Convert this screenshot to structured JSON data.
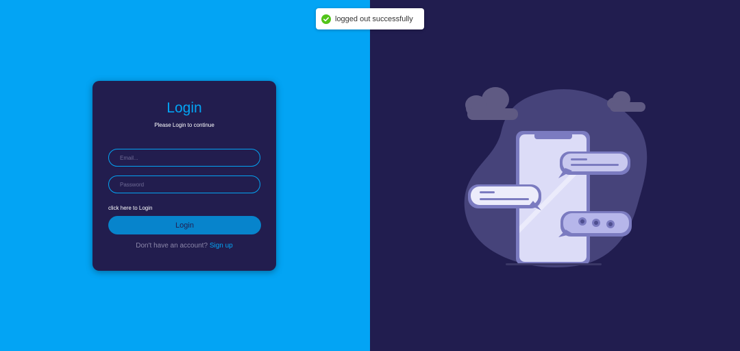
{
  "toast": {
    "message": "logged out successfully",
    "icon": "check-circle-icon",
    "icon_color": "#52c41a"
  },
  "login_form": {
    "title": "Login",
    "subtitle": "Please Login to continue",
    "email_placeholder": "Email...",
    "password_placeholder": "Password",
    "helper_text": "click here to Login",
    "button_label": "Login",
    "signup_prompt": "Don't have an account?",
    "signup_link": "Sign up"
  },
  "colors": {
    "accent": "#03a4f4",
    "left_background": "#03a4f4",
    "right_background": "#211d4f",
    "card_background": "#221d4e",
    "button_background": "#0784cc"
  },
  "illustration": {
    "icon": "phone-chat-illustration"
  }
}
